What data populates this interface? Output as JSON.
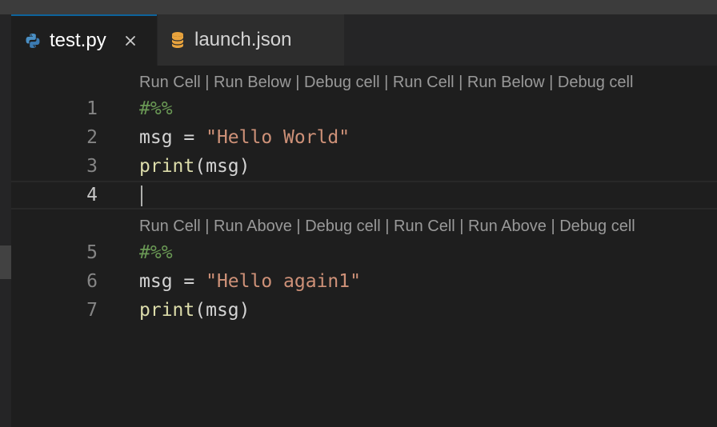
{
  "tabs": [
    {
      "label": "test.py",
      "icon": "python-icon",
      "active": true,
      "close": "×"
    },
    {
      "label": "launch.json",
      "icon": "json-icon",
      "active": false
    }
  ],
  "codelens": [
    {
      "items": [
        "Run Cell",
        "Run Below",
        "Debug cell",
        "Run Cell",
        "Run Below",
        "Debug cell"
      ],
      "separator": " | "
    },
    {
      "items": [
        "Run Cell",
        "Run Above",
        "Debug cell",
        "Run Cell",
        "Run Above",
        "Debug cell"
      ],
      "separator": " | "
    }
  ],
  "lines": [
    {
      "num": "1",
      "tokens": [
        {
          "t": "#%%",
          "k": "comment"
        }
      ]
    },
    {
      "num": "2",
      "tokens": [
        {
          "t": "msg",
          "k": "var"
        },
        {
          "t": " = ",
          "k": "op"
        },
        {
          "t": "\"Hello World\"",
          "k": "str"
        }
      ]
    },
    {
      "num": "3",
      "tokens": [
        {
          "t": "print",
          "k": "fn"
        },
        {
          "t": "(",
          "k": "punc"
        },
        {
          "t": "msg",
          "k": "var"
        },
        {
          "t": ")",
          "k": "punc"
        }
      ]
    },
    {
      "num": "4",
      "tokens": []
    },
    {
      "num": "5",
      "tokens": [
        {
          "t": "#%%",
          "k": "comment"
        }
      ]
    },
    {
      "num": "6",
      "tokens": [
        {
          "t": "msg",
          "k": "var"
        },
        {
          "t": " = ",
          "k": "op"
        },
        {
          "t": "\"Hello again1\"",
          "k": "str"
        }
      ]
    },
    {
      "num": "7",
      "tokens": [
        {
          "t": "print",
          "k": "fn"
        },
        {
          "t": "(",
          "k": "punc"
        },
        {
          "t": "msg",
          "k": "var"
        },
        {
          "t": ")",
          "k": "punc"
        }
      ]
    }
  ],
  "colors": {
    "editor_bg": "#1e1e1e",
    "tab_active_border": "#0e639c",
    "comment": "#6a9955",
    "string": "#ce9178",
    "function": "#dcdcaa",
    "python_icon_blue": "#4a8fc4",
    "json_icon_yellow": "#e8a33d"
  }
}
